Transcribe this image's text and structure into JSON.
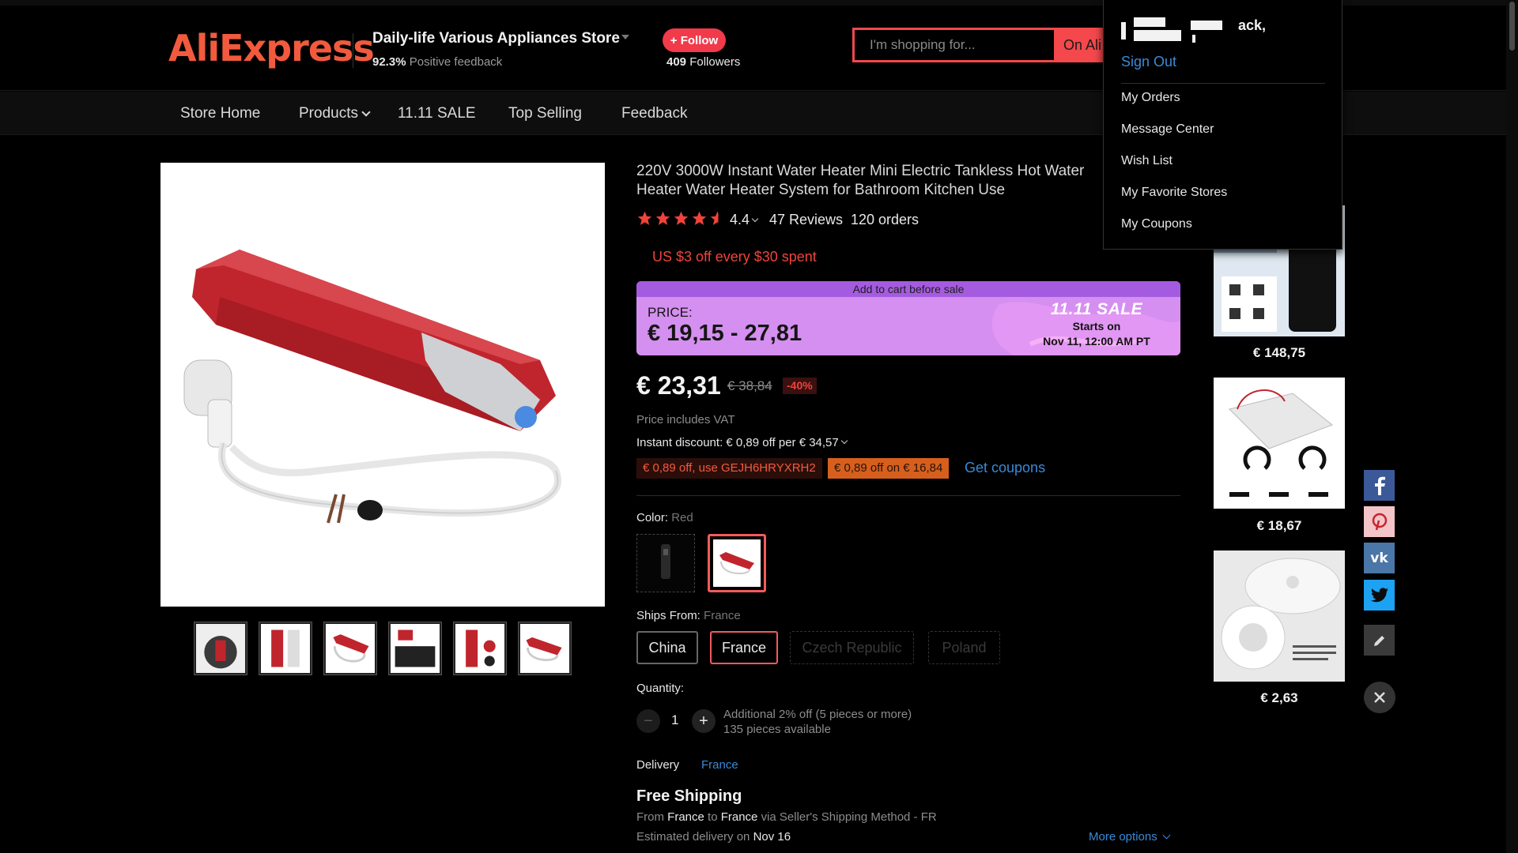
{
  "header": {
    "logo_text": "AliExpress",
    "store_name": "Daily-life Various Appliances Store",
    "positive_pct": "92.3%",
    "positive_label": "Positive feedback",
    "follow_label": "+ Follow",
    "followers_count": "409",
    "followers_label": "Followers",
    "search_placeholder": "I'm shopping for...",
    "search_scope": "On Ali"
  },
  "nav": {
    "items": [
      "Store Home",
      "Products",
      "11.11 SALE",
      "Top Selling",
      "Feedback"
    ]
  },
  "product": {
    "title": "220V 3000W Instant Water Heater Mini Electric Tankless Hot Water Heater Water Heater System for Bathroom Kitchen Use",
    "rating": "4.4",
    "rating_stars": 4.4,
    "reviews": "47 Reviews",
    "orders": "120 orders",
    "promo": "US $3 off every $30 spent",
    "sale": {
      "top_text": "Add to cart before sale",
      "price_label": "PRICE:",
      "price_range": "€ 19,15 - 27,81",
      "logo": "11.11 SALE",
      "starts": "Starts on",
      "date": "Nov 11, 12:00 AM PT"
    },
    "price": "€ 23,31",
    "old_price": "€ 38,84",
    "discount": "-40%",
    "vat": "Price includes VAT",
    "instant_discount": "Instant discount: € 0,89 off per € 34,57",
    "coupon1": "€ 0,89 off, use GEJH6HRYXRH2",
    "coupon2": "€ 0,89 off on € 16,84",
    "get_coupons": "Get coupons",
    "color_label": "Color:",
    "color_value": "Red",
    "ships_from_label": "Ships From:",
    "ships_from_value": "France",
    "ship_options": [
      "China",
      "France",
      "Czech Republic",
      "Poland"
    ],
    "quantity_label": "Quantity:",
    "quantity": "1",
    "qty_note1": "Additional 2% off (5 pieces or more)",
    "qty_note2": "135 pieces available",
    "delivery_label": "Delivery",
    "delivery_country": "France",
    "free_shipping": "Free Shipping",
    "ship_from_prefix": "From",
    "ship_from_origin": "France",
    "ship_from_to": "to",
    "ship_from_dest": "France",
    "ship_from_suffix": "via Seller's Shipping Method - FR",
    "est_prefix": "Estimated delivery on",
    "est_date": "Nov 16",
    "more_options": "More options"
  },
  "recommendations": [
    {
      "price": "€ 148,75"
    },
    {
      "price": "€ 18,67"
    },
    {
      "price": "€ 2,63"
    }
  ],
  "account_menu": {
    "greeting_suffix": "ack,",
    "sign_out": "Sign Out",
    "items": [
      "My Orders",
      "Message Center",
      "Wish List",
      "My Favorite Stores",
      "My Coupons"
    ]
  },
  "colors": {
    "accent": "#f25a3d",
    "follow": "#f13a4a",
    "link": "#3a8ad8",
    "sale_banner": "#d58ff0"
  },
  "share_icons": [
    "facebook-icon",
    "pinterest-icon",
    "vk-icon",
    "twitter-icon",
    "edit-icon"
  ]
}
